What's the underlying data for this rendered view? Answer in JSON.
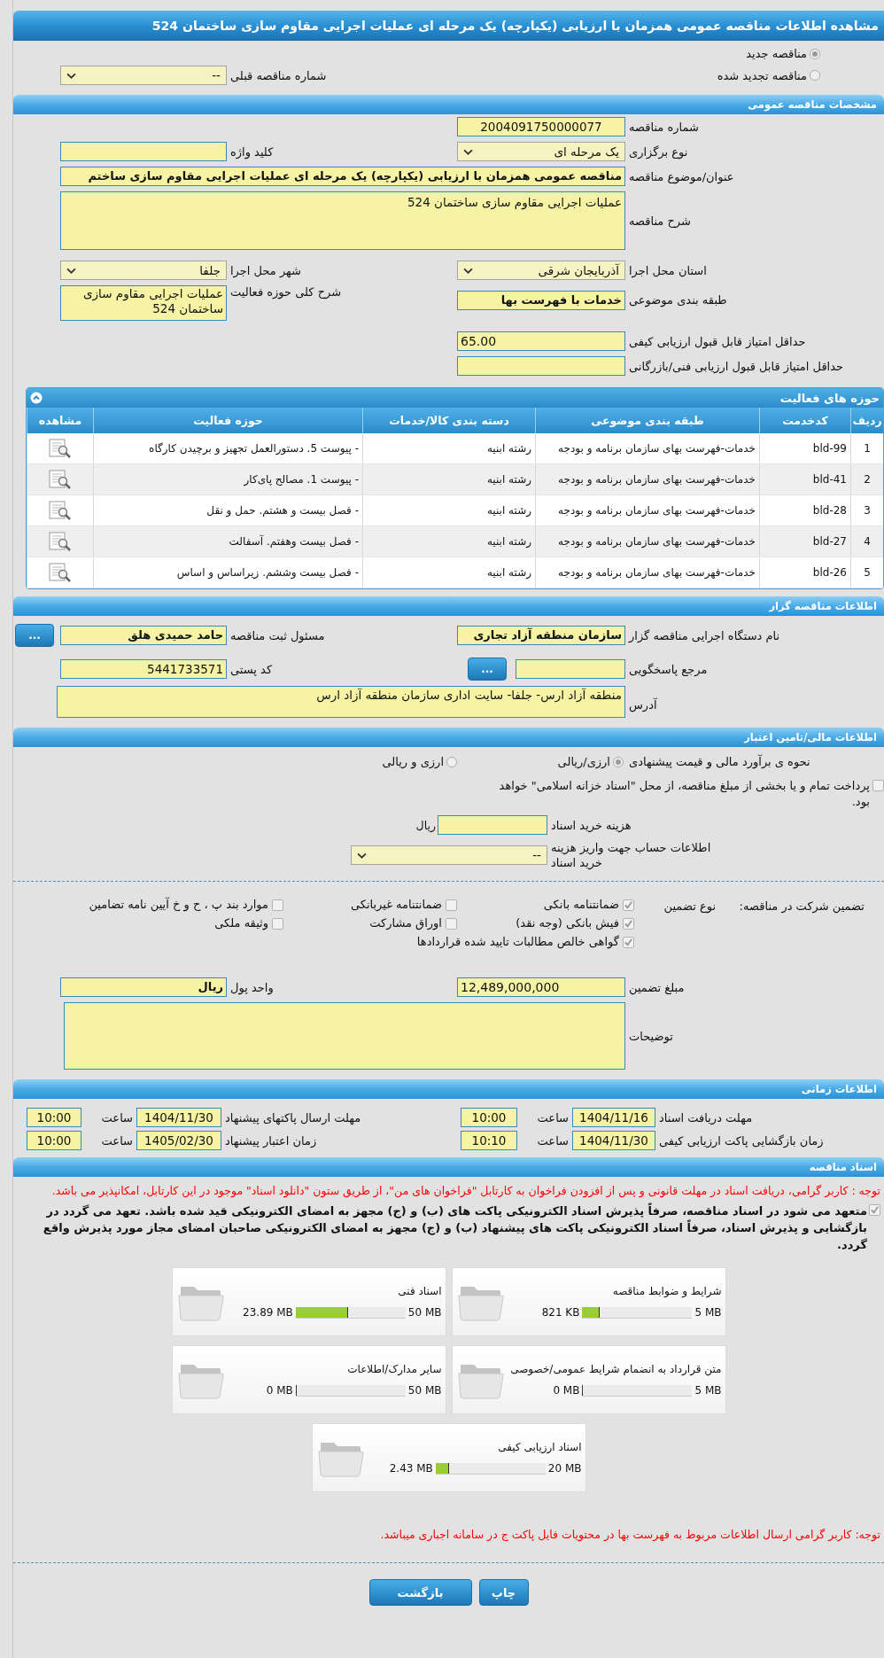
{
  "title": "مشاهده اطلاعات مناقصه عمومی همزمان با ارزیابی (یکپارچه) یک مرحله ای عملیات اجرایی مقاوم سازی ساختمان 524",
  "tender_kind": [
    {
      "label": "مناقصه جدید",
      "selected": true
    },
    {
      "label": "مناقصه تجدید شده",
      "selected": false
    }
  ],
  "previous_tender": {
    "label": "شماره مناقصه قبلی",
    "value": "--"
  },
  "general": {
    "heading": "مشخصات مناقصه عمومی",
    "number": {
      "label": "شماره مناقصه",
      "value": "2004091750000077"
    },
    "holding_type": {
      "label": "نوع برگزاری",
      "value": "یک مرحله ای"
    },
    "keyword": {
      "label": "کلید واژه"
    },
    "subject": {
      "label": "عنوان/موضوع مناقصه",
      "value": "مناقصه عمومی همزمان با ارزیابی (یکپارچه) یک مرحله ای عملیات اجرایی مقاوم سازی ساختم"
    },
    "description": {
      "label": "شرح مناقصه",
      "value": "عملیات اجرایی مقاوم سازی ساختمان 524"
    },
    "province": {
      "label": "استان محل اجرا",
      "value": "آذربایجان شرقی"
    },
    "city": {
      "label": "شهر محل اجرا",
      "value": "جلفا"
    },
    "classification": {
      "label": "طبقه بندی موضوعی",
      "value": "خدمات با فهرست بها"
    },
    "activity_summary": {
      "label": "شرح کلی حوزه فعالیت",
      "value": "عملیات اجرایی مقاوم سازی ساختمان 524"
    },
    "min_quality_score": {
      "label": "حداقل امتیاز قابل قبول ارزیابی کیفی",
      "value": "65.00"
    },
    "min_technical_score": {
      "label": "حداقل امتیاز قابل قبول ارزیابی فنی/بازرگانی"
    }
  },
  "activities": {
    "heading": "حوزه های فعالیت",
    "expanded": true,
    "columns": [
      "ردیف",
      "کدخدمت",
      "طبقه بندی موضوعی",
      "دسته بندی کالا/خدمات",
      "حوزه فعالیت",
      "مشاهده"
    ],
    "rows": [
      {
        "index": "1",
        "code": "bld-99",
        "classification": "خدمات-فهرست بهای سازمان برنامه و بودجه",
        "category": "رشته ابنیه",
        "activity": "- پیوست 5. دستورالعمل تجهیز و برچیدن کارگاه"
      },
      {
        "index": "2",
        "code": "bld-41",
        "classification": "خدمات-فهرست بهای سازمان برنامه و بودجه",
        "category": "رشته ابنیه",
        "activity": "- پیوست 1. مصالح پای‌کار"
      },
      {
        "index": "3",
        "code": "bld-28",
        "classification": "خدمات-فهرست بهای سازمان برنامه و بودجه",
        "category": "رشته ابنیه",
        "activity": "- فصل بیست و هشتم. حمل و نقل"
      },
      {
        "index": "4",
        "code": "bld-27",
        "classification": "خدمات-فهرست بهای سازمان برنامه و بودجه",
        "category": "رشته ابنیه",
        "activity": "- فصل بیست وهفتم. آسفالت"
      },
      {
        "index": "5",
        "code": "bld-26",
        "classification": "خدمات-فهرست بهای سازمان برنامه و بودجه",
        "category": "رشته ابنیه",
        "activity": "- فصل بیست وششم. زیراساس و اساس"
      }
    ]
  },
  "organizer": {
    "heading": "اطلاعات مناقصه گزار",
    "agency": {
      "label": "نام دستگاه اجرایی مناقصه گزار",
      "value": "سازمان منطقه آزاد تجاری"
    },
    "registrar": {
      "label": "مسئول ثبت مناقصه",
      "value": "حامد حمیدی هلق",
      "button": "..."
    },
    "reference": {
      "label": "مرجع پاسخگویی",
      "button": "..."
    },
    "postal_code": {
      "label": "کد پستی",
      "value": "5441733571"
    },
    "address": {
      "label": "آدرس",
      "value": "منطقه آزاد ارس- جلفا- سایت اداری سازمان منطقه آزاد ارس"
    }
  },
  "finance": {
    "heading": "اطلاعات مالی/تامین اعتبار",
    "estimate": {
      "label": "نحوه ی برآورد مالی و قیمت پیشنهادی",
      "options": [
        {
          "label": "ارزی/ریالی",
          "selected": true
        },
        {
          "label": "ارزی و ریالی",
          "selected": false
        }
      ]
    },
    "treasury": {
      "label": "پرداخت تمام و یا بخشی از مبلغ مناقصه، از محل \"اسناد خزانه اسلامی\" خواهد بود.",
      "checked": false
    },
    "document_fee": {
      "label": "هزینه خرید اسناد",
      "unit": "ریال"
    },
    "account": {
      "label": "اطلاعات حساب جهت واریز هزینه خرید اسناد",
      "value": "--"
    }
  },
  "guarantee": {
    "label": "تضمین شرکت در مناقصه:",
    "type_label": "نوع تضمین",
    "options": [
      {
        "label": "ضمانتنامه بانکی",
        "checked": true
      },
      {
        "label": "ضمانتنامه غیربانکی",
        "checked": false
      },
      {
        "label": "موارد بند پ ، ح و خ آیین نامه تضامین",
        "checked": false
      },
      {
        "label": "فیش بانکی (وجه نقد)",
        "checked": true
      },
      {
        "label": "اوراق مشارکت",
        "checked": false
      },
      {
        "label": "وثیقه ملکی",
        "checked": false
      },
      {
        "label": "گواهی خالص مطالبات تایید شده قراردادها",
        "checked": true
      }
    ],
    "amount": {
      "label": "مبلغ تضمین",
      "value": "12,489,000,000"
    },
    "currency": {
      "label": "واحد پول",
      "value": "ریال"
    },
    "notes": {
      "label": "توضیحات"
    }
  },
  "schedule": {
    "heading": "اطلاعات زمانی",
    "items": [
      {
        "label": "مهلت دریافت اسناد",
        "date": "1404/11/16",
        "time_label": "ساعت",
        "time": "10:00"
      },
      {
        "label": "مهلت ارسال پاکتهای پیشنهاد",
        "date": "1404/11/30",
        "time_label": "ساعت",
        "time": "10:00"
      },
      {
        "label": "زمان بازگشایی پاکت ارزیابی کیفی",
        "date": "1404/11/30",
        "time_label": "ساعت",
        "time": "10:10"
      },
      {
        "label": "زمان اعتبار پیشنهاد",
        "date": "1405/02/30",
        "time_label": "ساعت",
        "time": "10:00"
      }
    ]
  },
  "documents": {
    "heading": "اسناد مناقصه",
    "notice": "توجه : کاربر گرامی، دریافت اسناد در مهلت قانونی و پس از افزودن فراخوان به کارتابل \"فراخوان های من\"، از طریق ستون \"دانلود اسناد\" موجود در این کارتابل، امکانپذیر می باشد.",
    "commitment": {
      "text": "متعهد می شود در اسناد مناقصه، صرفاً پذیرش اسناد الکترونیکی پاکت های (ب) و (ج) مجهز به امضای الکترونیکی قید شده باشد. تعهد می گردد در بازگشایی و پذیرش اسناد، صرفاً اسناد الکترونیکی پاکت های پیشنهاد (ب) و (ج) مجهز به امضای الکترونیکی صاحبان امضای مجاز مورد پذیرش واقع گردد.",
      "checked": true
    },
    "files": [
      {
        "name": "شرایط و ضوابط مناقصه",
        "size": "821 KB",
        "limit": "5 MB",
        "level": 0.16
      },
      {
        "name": "اسناد فنی",
        "size": "23.89 MB",
        "limit": "50 MB",
        "level": 0.48
      },
      {
        "name": "متن قرارداد به انضمام شرایط عمومی/خصوصی",
        "size": "0 MB",
        "limit": "5 MB",
        "level": 0
      },
      {
        "name": "سایر مدارک/اطلاعات",
        "size": "0 MB",
        "limit": "50 MB",
        "level": 0
      },
      {
        "name": "اسناد ارزیابی کیفی",
        "size": "2.43 MB",
        "limit": "20 MB",
        "level": 0.12
      }
    ],
    "footer_notice": "توجه: کاربر گرامی ارسال اطلاعات مربوط به فهرست بها در محتویات فایل پاکت ج در سامانه اجباری میباشد."
  },
  "buttons": [
    {
      "label": "چاپ"
    },
    {
      "label": "بازگشت"
    }
  ]
}
